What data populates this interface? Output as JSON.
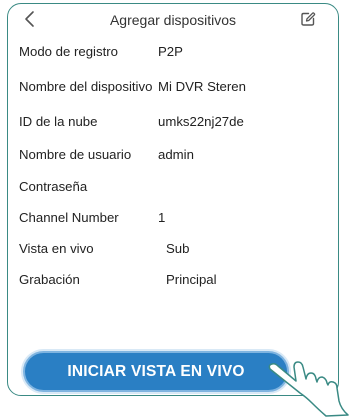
{
  "header": {
    "title": "Agregar dispositivos",
    "back_icon": "chevron-left-icon",
    "edit_icon": "edit-square-icon"
  },
  "form": {
    "rows": [
      {
        "label": "Modo de registro",
        "value": "P2P"
      },
      {
        "label": "Nombre del dispositivo",
        "value": "Mi DVR Steren"
      },
      {
        "label": "ID de la nube",
        "value": "umks22nj27de"
      },
      {
        "label": "Nombre de usuario",
        "value": "admin"
      },
      {
        "label": "Contraseña",
        "value": ""
      },
      {
        "label": "Channel Number",
        "value": "1"
      },
      {
        "label": "Vista en vivo",
        "value": "Sub"
      },
      {
        "label": "Grabación",
        "value": "Principal"
      }
    ]
  },
  "cta": {
    "label": "INICIAR VISTA EN VIVO"
  },
  "overlay": {
    "pointer": "hand-pointer-icon"
  },
  "colors": {
    "frame_border": "#3a8a84",
    "button_bg": "#2a7fc4",
    "button_text": "#ffffff"
  }
}
